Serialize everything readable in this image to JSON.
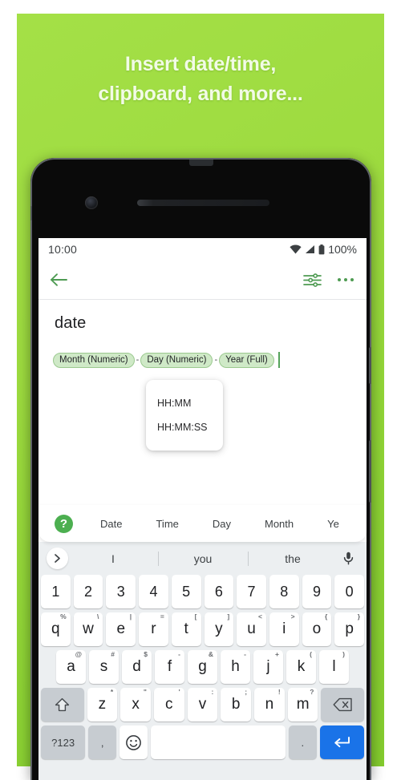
{
  "promo": {
    "headline_line1": "Insert date/time,",
    "headline_line2": "clipboard, and more...",
    "background_color": "#9ddb3f",
    "text_color": "#f2fbe6"
  },
  "phone": {
    "statusbar": {
      "time": "10:00",
      "battery_percent": "100%",
      "icons": [
        "wifi-icon",
        "signal-icon",
        "battery-icon"
      ]
    },
    "toolbar": {
      "back_icon": "arrow-left-icon",
      "tune_icon": "sliders-icon",
      "overflow_icon": "more-vert-icon",
      "accent_color": "#4e9b52"
    },
    "editor": {
      "title": "date",
      "chips": [
        {
          "label": "Month (Numeric)"
        },
        {
          "label": "Day (Numeric)"
        },
        {
          "label": "Year (Full)"
        }
      ],
      "chip_separator": "-",
      "chip_bg": "#cfe9c7",
      "chip_border": "#9bc98f",
      "caret_color": "#56a35b"
    },
    "popup": {
      "items": [
        "HH:MM",
        "HH:MM:SS"
      ]
    },
    "tabbar": {
      "help_label": "?",
      "help_color": "#4caf50",
      "tabs": [
        "Date",
        "Time",
        "Day",
        "Month",
        "Ye"
      ]
    },
    "keyboard": {
      "suggestions": {
        "expand_icon": "chevron-right-icon",
        "words": [
          "I",
          "you",
          "the"
        ],
        "mic_icon": "microphone-icon"
      },
      "row_numbers": [
        {
          "main": "1"
        },
        {
          "main": "2"
        },
        {
          "main": "3"
        },
        {
          "main": "4"
        },
        {
          "main": "5"
        },
        {
          "main": "6"
        },
        {
          "main": "7"
        },
        {
          "main": "8"
        },
        {
          "main": "9"
        },
        {
          "main": "0"
        }
      ],
      "row_top": [
        {
          "main": "q",
          "sup": "%"
        },
        {
          "main": "w",
          "sup": "\\"
        },
        {
          "main": "e",
          "sup": "|"
        },
        {
          "main": "r",
          "sup": "="
        },
        {
          "main": "t",
          "sup": "["
        },
        {
          "main": "y",
          "sup": "]"
        },
        {
          "main": "u",
          "sup": "<"
        },
        {
          "main": "i",
          "sup": ">"
        },
        {
          "main": "o",
          "sup": "{"
        },
        {
          "main": "p",
          "sup": "}"
        }
      ],
      "row_home": [
        {
          "main": "a",
          "sup": "@"
        },
        {
          "main": "s",
          "sup": "#"
        },
        {
          "main": "d",
          "sup": "$"
        },
        {
          "main": "f",
          "sup": "-"
        },
        {
          "main": "g",
          "sup": "&"
        },
        {
          "main": "h",
          "sup": "-"
        },
        {
          "main": "j",
          "sup": "+"
        },
        {
          "main": "k",
          "sup": "("
        },
        {
          "main": "l",
          "sup": ")"
        }
      ],
      "row_bottom": [
        {
          "main": "z",
          "sup": "*"
        },
        {
          "main": "x",
          "sup": "\""
        },
        {
          "main": "c",
          "sup": "'"
        },
        {
          "main": "v",
          "sup": ":"
        },
        {
          "main": "b",
          "sup": ";"
        },
        {
          "main": "n",
          "sup": "!"
        },
        {
          "main": "m",
          "sup": "?"
        }
      ],
      "shift_icon": "shift-icon",
      "backspace_icon": "backspace-icon",
      "symbols_label": "?123",
      "comma_label": ",",
      "emoji_icon": "emoji-icon",
      "space_label": "",
      "period_label": ".",
      "enter_icon": "enter-icon",
      "enter_color": "#1a73e8",
      "key_bg": "#ffffff",
      "modifier_bg": "#c7ccd1",
      "keyboard_bg": "#eceff1"
    }
  }
}
